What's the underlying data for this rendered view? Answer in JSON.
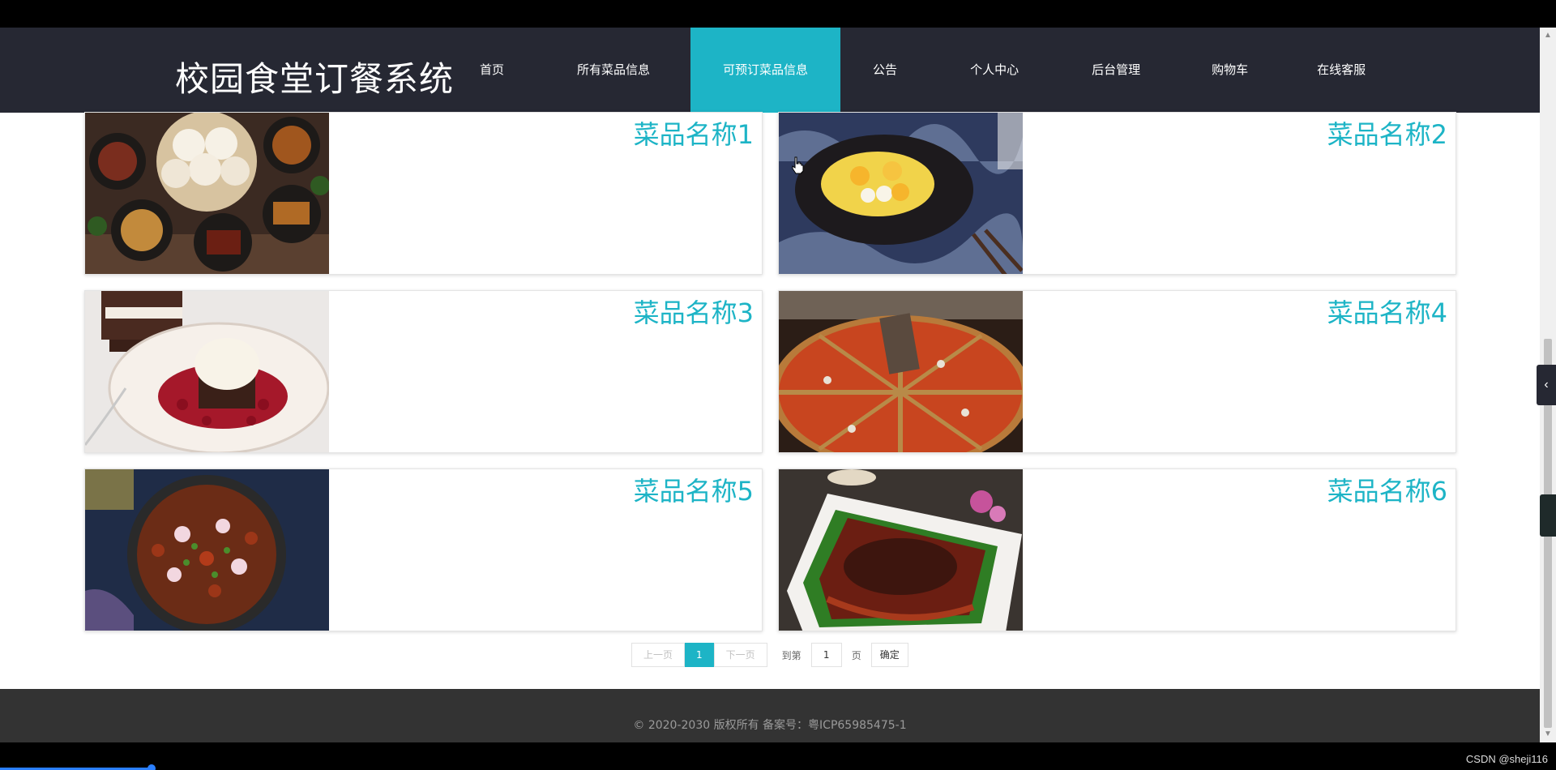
{
  "site_title": "校园食堂订餐系统",
  "nav": [
    {
      "label": "首页"
    },
    {
      "label": "所有菜品信息"
    },
    {
      "label": "可预订菜品信息",
      "active": true
    },
    {
      "label": "公告"
    },
    {
      "label": "个人中心"
    },
    {
      "label": "后台管理"
    },
    {
      "label": "购物车"
    },
    {
      "label": "在线客服"
    }
  ],
  "items": [
    {
      "title": "菜品名称1",
      "image": "steamed-buns-platter-photo"
    },
    {
      "title": "菜品名称2",
      "image": "mango-dessert-photo"
    },
    {
      "title": "菜品名称3",
      "image": "ice-cream-brownie-photo"
    },
    {
      "title": "菜品名称4",
      "image": "hotpot-photo"
    },
    {
      "title": "菜品名称5",
      "image": "spicy-chicken-photo"
    },
    {
      "title": "菜品名称6",
      "image": "braised-beef-photo"
    }
  ],
  "pagination": {
    "prev": "上一页",
    "current": "1",
    "next": "下一页",
    "goto_label": "到第",
    "page_value": "1",
    "page_unit": "页",
    "confirm": "确定"
  },
  "footer": {
    "text": "© 2020-2030 版权所有 备案号：粤ICP65985475-1"
  },
  "watermark": "CSDN @sheji116",
  "colors": {
    "accent": "#1db4c6",
    "header_bg": "#262833",
    "footer_bg": "#333333"
  }
}
